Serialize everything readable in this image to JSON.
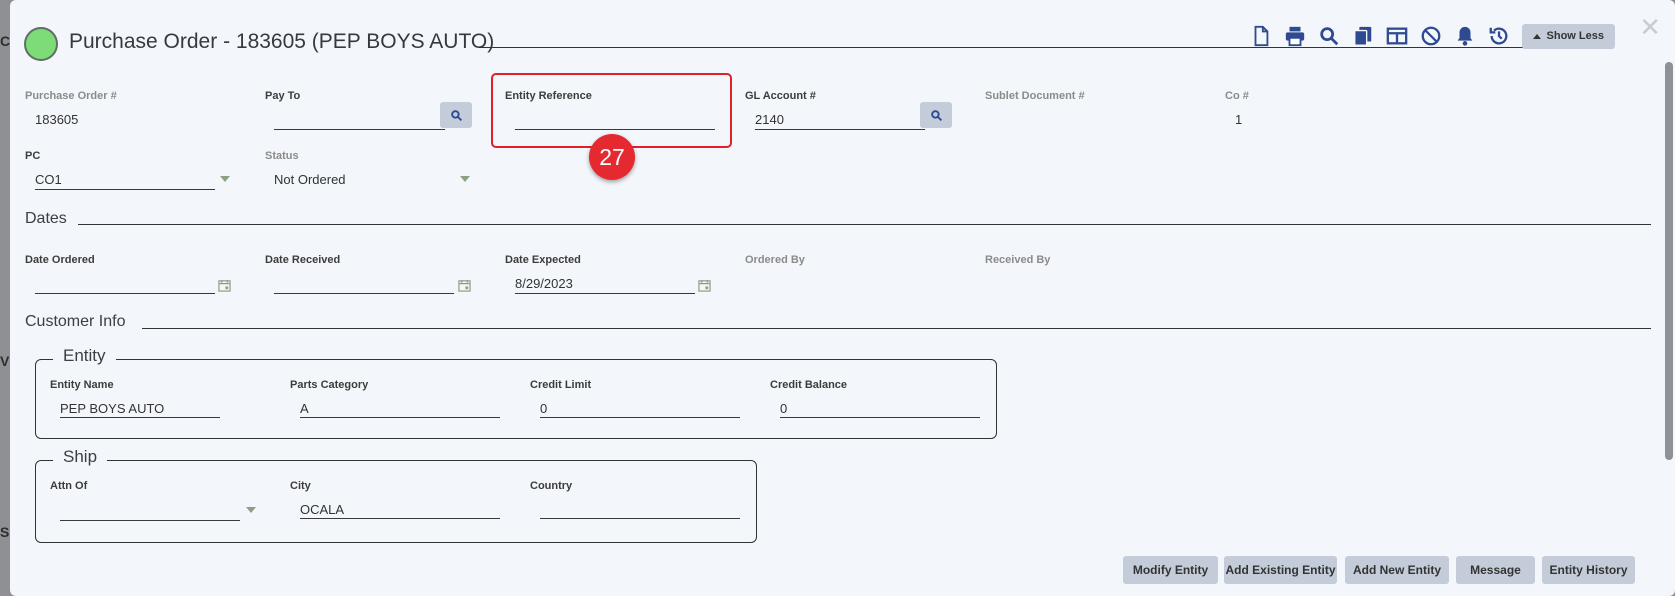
{
  "background_letters": [
    "C",
    "V",
    "S"
  ],
  "header": {
    "title": "Purchase Order - 183605 (PEP BOYS AUTO)",
    "status_color": "#7ddc78",
    "toolbar_icons": [
      "document-icon",
      "print-icon",
      "search-icon",
      "copy-icon",
      "layout-icon",
      "cancel-icon",
      "bell-icon",
      "history-icon"
    ],
    "show_less_label": "Show Less"
  },
  "fields": {
    "po_number": {
      "label": "Purchase Order #",
      "value": "183605"
    },
    "pay_to": {
      "label": "Pay To",
      "value": ""
    },
    "entity_reference": {
      "label": "Entity Reference",
      "value": ""
    },
    "gl_account": {
      "label": "GL Account #",
      "value": "2140"
    },
    "sublet_doc": {
      "label": "Sublet Document #",
      "value": ""
    },
    "co_number": {
      "label": "Co #",
      "value": "1"
    },
    "pc": {
      "label": "PC",
      "value": "CO1"
    },
    "status": {
      "label": "Status",
      "value": "Not Ordered"
    }
  },
  "dates": {
    "section_title": "Dates",
    "date_ordered": {
      "label": "Date Ordered",
      "value": ""
    },
    "date_received": {
      "label": "Date Received",
      "value": ""
    },
    "date_expected": {
      "label": "Date Expected",
      "value": "8/29/2023"
    },
    "ordered_by": {
      "label": "Ordered By",
      "value": ""
    },
    "received_by": {
      "label": "Received By",
      "value": ""
    }
  },
  "customer_info": {
    "section_title": "Customer Info",
    "entity": {
      "legend": "Entity",
      "entity_name": {
        "label": "Entity Name",
        "value": "PEP BOYS AUTO"
      },
      "parts_category": {
        "label": "Parts Category",
        "value": "A"
      },
      "credit_limit": {
        "label": "Credit Limit",
        "value": "0"
      },
      "credit_balance": {
        "label": "Credit Balance",
        "value": "0"
      }
    },
    "ship": {
      "legend": "Ship",
      "attn_of": {
        "label": "Attn Of",
        "value": ""
      },
      "city": {
        "label": "City",
        "value": "OCALA"
      },
      "country": {
        "label": "Country",
        "value": ""
      }
    }
  },
  "annotation": {
    "step_number": "27",
    "color": "#e42a30"
  },
  "actions": {
    "modify_entity": "Modify Entity",
    "add_existing_entity": "Add Existing Entity",
    "add_new_entity": "Add New Entity",
    "message": "Message",
    "entity_history": "Entity History"
  }
}
